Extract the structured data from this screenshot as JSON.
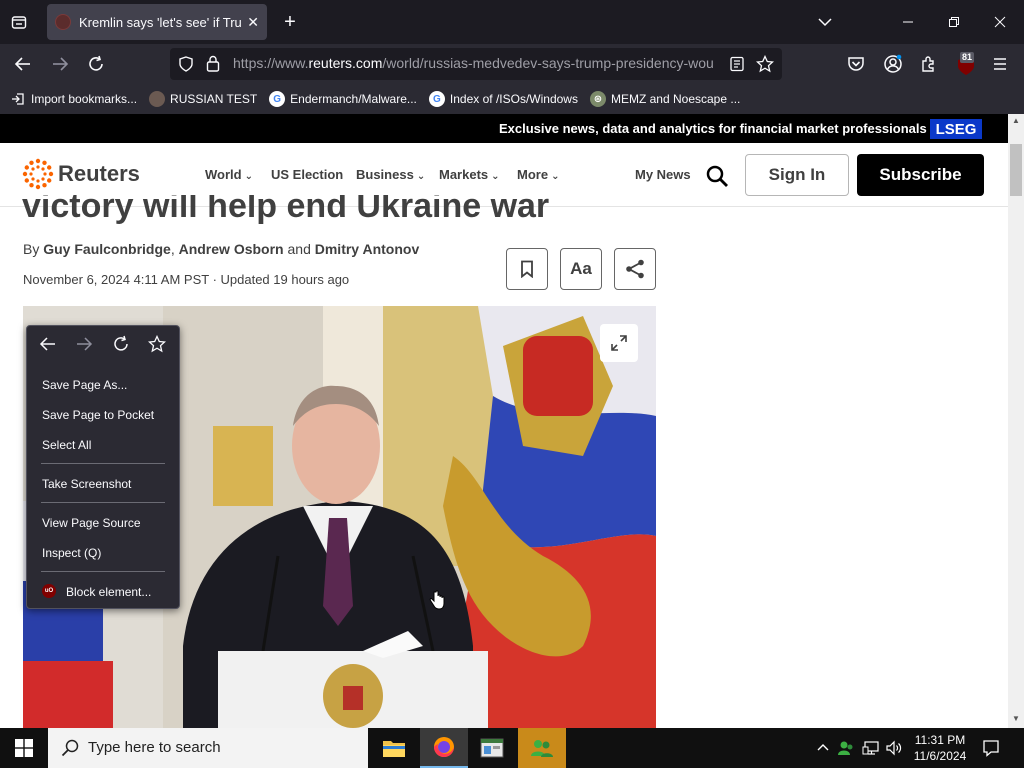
{
  "browser": {
    "tab_title": "Kremlin says 'let's see' if Trump",
    "url_prefix": "https://www.",
    "url_domain": "reuters.com",
    "url_path": "/world/russias-medvedev-says-trump-presidency-wou",
    "extension_badge": "81",
    "bookmarks": [
      {
        "label": "Import bookmarks...",
        "icon": "import-icon"
      },
      {
        "label": "RUSSIAN TEST",
        "icon": "person-icon"
      },
      {
        "label": "Endermanch/Malware...",
        "icon": "google-icon"
      },
      {
        "label": "Index of /ISOs/Windows",
        "icon": "google-icon"
      },
      {
        "label": "MEMZ and Noescape ...",
        "icon": "globe-icon"
      }
    ]
  },
  "page": {
    "promo_text": "Exclusive news, data and analytics for financial market professionals",
    "promo_logo": "LSEG",
    "brand": "Reuters",
    "nav": [
      "World",
      "US Election",
      "Business",
      "Markets",
      "More"
    ],
    "my_news": "My News",
    "sign_in": "Sign In",
    "subscribe": "Subscribe",
    "headline_tail": "victory will help end Ukraine war",
    "byline_prefix": "By ",
    "authors": [
      "Guy Faulconbridge",
      "Andrew Osborn",
      "Dmitry Antonov"
    ],
    "byline_sep": ", ",
    "byline_and": " and ",
    "dateline": "November 6, 2024 4:11 AM PST · Updated 19 hours ago",
    "text_size_label": "Aa"
  },
  "context_menu": {
    "items": [
      {
        "label": "Save Page As..."
      },
      {
        "label": "Save Page to Pocket"
      },
      {
        "label": "Select All"
      },
      {
        "label": "Take Screenshot"
      },
      {
        "label": "View Page Source"
      },
      {
        "label": "Inspect (Q)"
      },
      {
        "label": "Block element..."
      }
    ],
    "ublock_badge": "uO"
  },
  "taskbar": {
    "search_placeholder": "Type here to search",
    "time": "11:31 PM",
    "date": "11/6/2024"
  },
  "colors": {
    "reuters_orange": "#fa6400",
    "lseg_blue": "#0a38c9",
    "firefox_dark": "#1c1b22"
  }
}
